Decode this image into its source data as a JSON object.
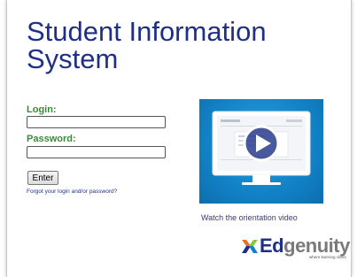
{
  "header": {
    "title_line1": "Student Information",
    "title_line2": "System"
  },
  "login_form": {
    "login_label": "Login:",
    "login_value": "",
    "password_label": "Password:",
    "password_value": "",
    "enter_label": "Enter",
    "forgot_link": "Forgot your login and/or password?"
  },
  "video": {
    "caption": "Watch the orientation video",
    "icon": "play-icon",
    "accent": "#1282c6"
  },
  "brand": {
    "name_part1": "Ed",
    "name_part2": "genuity",
    "tagline": "where learning clicks",
    "colors": {
      "primary": "#1f2f86",
      "secondary": "#7a7a7a",
      "orange": "#f26b21",
      "green": "#8cc63f",
      "blue": "#1f2f86"
    }
  },
  "colors": {
    "title": "#1f2f86",
    "label": "#3a8a3a"
  }
}
